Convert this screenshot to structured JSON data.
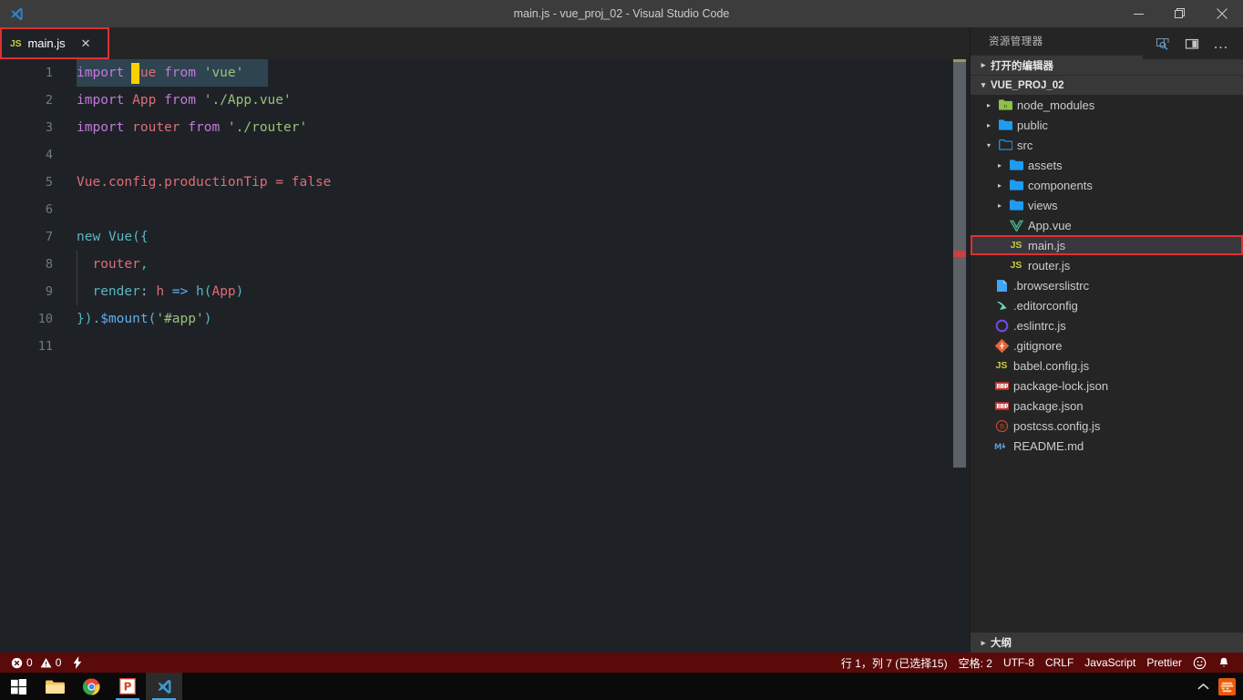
{
  "window": {
    "title": "main.js - vue_proj_02 - Visual Studio Code",
    "logo_icon": "vscode-logo-icon",
    "minimize_icon": "minimize-icon",
    "maximize_icon": "restore-icon",
    "close_icon": "close-icon"
  },
  "tabs": [
    {
      "icon_label": "JS",
      "label": "main.js",
      "close_label": "✕",
      "active": true
    }
  ],
  "editor_actions": [
    {
      "name": "open-preview-to-side",
      "icon": "preview-side-icon"
    },
    {
      "name": "split-editor-right",
      "icon": "split-editor-icon"
    },
    {
      "name": "more-actions",
      "icon": "ellipsis-icon",
      "label": "…"
    }
  ],
  "editor": {
    "language": "JavaScript",
    "lines": [
      {
        "n": 1,
        "text": "import Vue from 'vue'"
      },
      {
        "n": 2,
        "text": "import App from './App.vue'"
      },
      {
        "n": 3,
        "text": "import router from './router'"
      },
      {
        "n": 4,
        "text": ""
      },
      {
        "n": 5,
        "text": "Vue.config.productionTip = false"
      },
      {
        "n": 6,
        "text": ""
      },
      {
        "n": 7,
        "text": "new Vue({"
      },
      {
        "n": 8,
        "text": "  router,"
      },
      {
        "n": 9,
        "text": "  render: h => h(App)"
      },
      {
        "n": 10,
        "text": "}).$mount('#app')"
      },
      {
        "n": 11,
        "text": ""
      }
    ],
    "selection_line": 1,
    "selection_text": " Vue from 'vue'",
    "cursor_column": 7,
    "colors": {
      "background": "#1e2227",
      "selection": "#2e4450",
      "cursor": "#ffd000",
      "keyword": "#c678dd",
      "identifier": "#e06c75",
      "string": "#98c379",
      "function": "#61afef",
      "punctuation": "#56b6c2",
      "linenumber": "#6d7a86"
    }
  },
  "sidebar": {
    "title": "资源管理器",
    "sections": [
      {
        "label": "打开的编辑器",
        "expanded": false
      },
      {
        "label": "VUE_PROJ_02",
        "expanded": true
      }
    ],
    "outline_label": "大纲",
    "tree": [
      {
        "label": "node_modules",
        "icon": "folder-node-modules-icon",
        "kind": "folder",
        "depth": 1,
        "expanded": false
      },
      {
        "label": "public",
        "icon": "folder-icon",
        "kind": "folder",
        "depth": 1,
        "expanded": false
      },
      {
        "label": "src",
        "icon": "folder-open-icon",
        "kind": "folder",
        "depth": 1,
        "expanded": true
      },
      {
        "label": "assets",
        "icon": "folder-icon",
        "kind": "folder",
        "depth": 2,
        "expanded": false
      },
      {
        "label": "components",
        "icon": "folder-icon",
        "kind": "folder",
        "depth": 2,
        "expanded": false
      },
      {
        "label": "views",
        "icon": "folder-icon",
        "kind": "folder",
        "depth": 2,
        "expanded": false
      },
      {
        "label": "App.vue",
        "icon": "vue-file-icon",
        "kind": "file",
        "depth": 2
      },
      {
        "label": "main.js",
        "icon": "js-file-icon",
        "kind": "file",
        "depth": 2,
        "selected": true,
        "highlighted": true
      },
      {
        "label": "router.js",
        "icon": "js-file-icon",
        "kind": "file",
        "depth": 2
      },
      {
        "label": ".browserslistrc",
        "icon": "text-file-icon",
        "kind": "file",
        "depth": 1
      },
      {
        "label": ".editorconfig",
        "icon": "editorconfig-icon",
        "kind": "file",
        "depth": 1
      },
      {
        "label": ".eslintrc.js",
        "icon": "eslint-icon",
        "kind": "file",
        "depth": 1
      },
      {
        "label": ".gitignore",
        "icon": "git-icon",
        "kind": "file",
        "depth": 1
      },
      {
        "label": "babel.config.js",
        "icon": "js-file-icon",
        "kind": "file",
        "depth": 1
      },
      {
        "label": "package-lock.json",
        "icon": "npm-icon",
        "kind": "file",
        "depth": 1
      },
      {
        "label": "package.json",
        "icon": "npm-icon",
        "kind": "file",
        "depth": 1
      },
      {
        "label": "postcss.config.js",
        "icon": "postcss-icon",
        "kind": "file",
        "depth": 1
      },
      {
        "label": "README.md",
        "icon": "markdown-icon",
        "kind": "file",
        "depth": 1
      }
    ]
  },
  "statusbar": {
    "background": "#5b0a0a",
    "errors": "0",
    "warnings": "0",
    "error_icon": "error-circle-icon",
    "warning_icon": "warning-triangle-icon",
    "radon_icon": "lightning-icon",
    "position": "行 1，列 7 (已选择15)",
    "indentation": "空格: 2",
    "encoding": "UTF-8",
    "eol": "CRLF",
    "language": "JavaScript",
    "formatter": "Prettier",
    "feedback_icon": "smiley-icon",
    "bell_icon": "bell-icon"
  },
  "taskbar": {
    "items": [
      {
        "name": "start-button",
        "icon": "windows-logo-icon"
      },
      {
        "name": "file-explorer",
        "icon": "folder-icon"
      },
      {
        "name": "google-chrome",
        "icon": "chrome-icon"
      },
      {
        "name": "powerpoint",
        "icon": "powerpoint-icon"
      },
      {
        "name": "visual-studio-code",
        "icon": "vscode-icon",
        "active": true
      }
    ],
    "tray": [
      {
        "name": "show-hidden-icons",
        "icon": "chevron-up-icon"
      },
      {
        "name": "tray-app-icon",
        "icon": "orange-app-icon"
      }
    ]
  }
}
